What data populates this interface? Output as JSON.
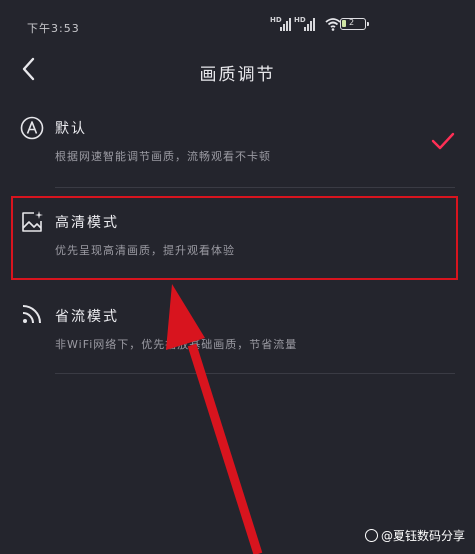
{
  "status_bar": {
    "time": "下午3:53",
    "signal1_label": "HD",
    "signal2_label": "HD",
    "battery_level": "2",
    "battery_fraction": 0.2,
    "wifi_icon": "wifi-icon"
  },
  "header": {
    "back_icon": "chevron-left-icon",
    "title": "画质调节"
  },
  "options": [
    {
      "icon": "auto-a-icon",
      "title": "默认",
      "description": "根据网速智能调节画质，流畅观看不卡顿",
      "selected": true
    },
    {
      "icon": "image-sparkle-icon",
      "title": "高清模式",
      "description": "优先呈现高清画质，提升观看体验",
      "selected": false,
      "highlighted": true
    },
    {
      "icon": "signal-waves-icon",
      "title": "省流模式",
      "description": "非WiFi网络下，优先播放基础画质，节省流量",
      "selected": false
    }
  ],
  "colors": {
    "background": "#24252d",
    "check_accent": "#ff2f55",
    "annotation_red": "#d8141e"
  },
  "watermark": {
    "text": "@夏钰数码分享"
  }
}
